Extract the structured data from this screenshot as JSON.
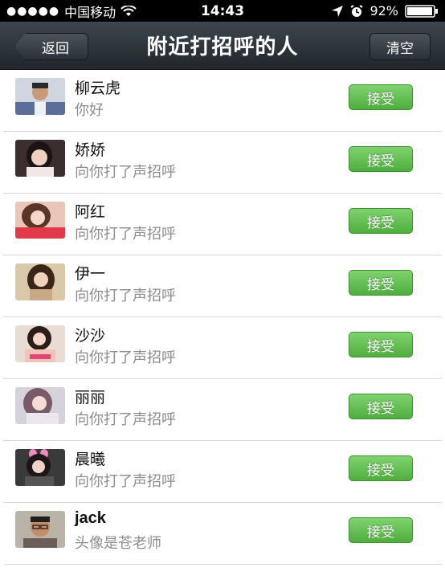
{
  "status_bar": {
    "signal": "●●●●●",
    "carrier": "中国移动",
    "time": "14:43",
    "battery": "92%"
  },
  "nav": {
    "back_label": "返回",
    "title": "附近打招呼的人",
    "clear_label": "清空"
  },
  "accept_label": "接受",
  "people": [
    {
      "name": "柳云虎",
      "message": "你好"
    },
    {
      "name": "娇娇",
      "message": "向你打了声招呼"
    },
    {
      "name": "阿红",
      "message": "向你打了声招呼"
    },
    {
      "name": "伊一",
      "message": "向你打了声招呼"
    },
    {
      "name": "沙沙",
      "message": "向你打了声招呼"
    },
    {
      "name": "丽丽",
      "message": "向你打了声招呼"
    },
    {
      "name": "晨曦",
      "message": "向你打了声招呼"
    },
    {
      "name": "jack",
      "message": "头像是苍老师"
    }
  ],
  "colors": {
    "nav_bg": "#2c3238",
    "accept_green": "#5fbf4d"
  }
}
